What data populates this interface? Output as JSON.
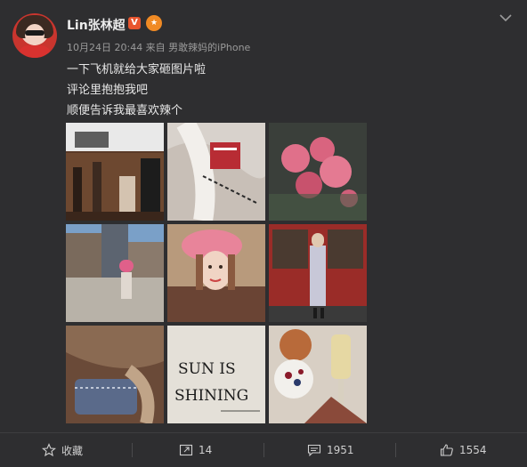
{
  "post": {
    "username": "Lin张林超",
    "badge_v": "V",
    "meta": "10月24日 20:44 来自 男敢辣妈的iPhone",
    "lines": [
      "一下飞机就给大家砸图片啦",
      "评论里抱抱我吧",
      "顺便告诉我最喜欢辣个"
    ]
  },
  "images": {
    "sun_text_1": "SUN IS",
    "sun_text_2": "SHINING"
  },
  "actions": {
    "favorite_label": "收藏",
    "repost_count": "14",
    "comment_count": "1951",
    "like_count": "1554"
  },
  "colors": {
    "background": "#2e2e30",
    "vip_badge": "#e8552f",
    "crown_badge": "#f08a24"
  }
}
